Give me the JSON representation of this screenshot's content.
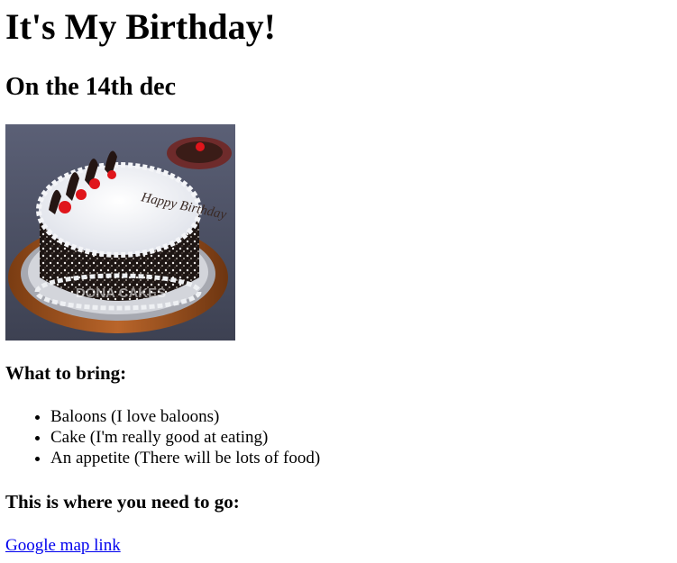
{
  "page": {
    "title": "It's My Birthday!",
    "subtitle": "On the 14th dec"
  },
  "image": {
    "alt": "birthday cake",
    "watermark": "DONA CAKES",
    "cake_writing": "Happy Birthday"
  },
  "bring": {
    "heading": "What to bring:",
    "items": [
      "Baloons (I love baloons)",
      "Cake (I'm really good at eating)",
      "An appetite (There will be lots of food)"
    ]
  },
  "location": {
    "heading": "This is where you need to go:",
    "link_label": "Google map link"
  }
}
